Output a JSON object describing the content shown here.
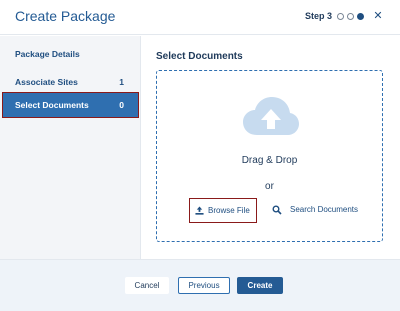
{
  "header": {
    "title": "Create Package",
    "step_label": "Step 3",
    "steps_total": 3,
    "current_step": 3,
    "close_icon": "close-icon"
  },
  "sidebar": {
    "items": [
      {
        "label": "Package Details",
        "count": ""
      },
      {
        "label": "Associate Sites",
        "count": "1"
      },
      {
        "label": "Select Documents",
        "count": "0",
        "active": true
      }
    ]
  },
  "main": {
    "section_title": "Select Documents",
    "dropzone": {
      "icon": "cloud-upload-icon",
      "drag_text": "Drag & Drop",
      "or_text": "or",
      "browse_label": "Browse File",
      "browse_icon": "upload-icon",
      "search_label": "Search Documents",
      "search_icon": "search-icon"
    }
  },
  "footer": {
    "cancel_label": "Cancel",
    "previous_label": "Previous",
    "create_label": "Create"
  },
  "colors": {
    "accent": "#245b94",
    "active_nav_bg": "#2f6fb0",
    "highlight_border": "#8a1a1a",
    "cloud": "#c7dbef"
  }
}
